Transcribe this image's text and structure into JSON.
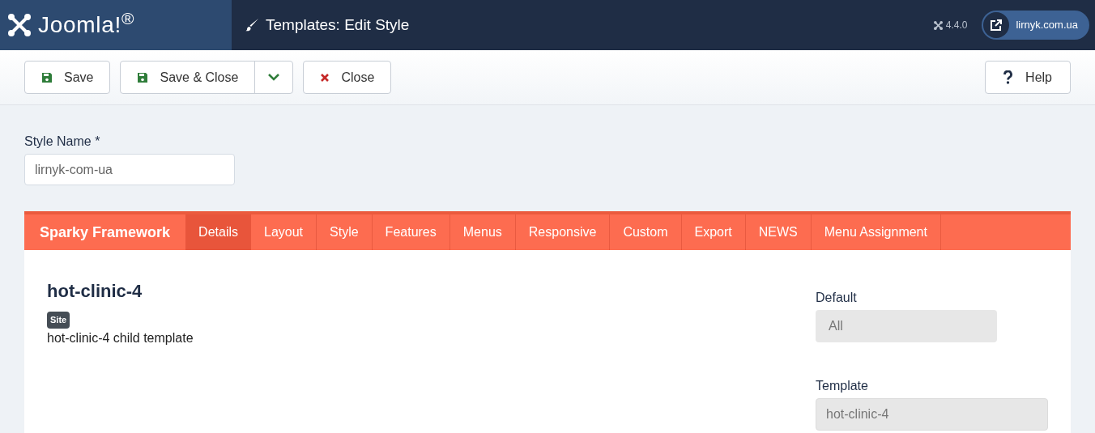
{
  "header": {
    "logo": "Joomla!$^{®}$",
    "title": "Templates: Edit Style",
    "version": "4.4.0",
    "site_link": "lirnyk.com.ua"
  },
  "toolbar": {
    "buttons": [
      {
        "kind": "save",
        "label": "Save"
      },
      {
        "kind": "save-close",
        "label": "Save & Close"
      },
      {
        "kind": "close",
        "label": "Close"
      }
    ],
    "help": "Help"
  },
  "style_name": {
    "label": "Style Name *",
    "value": "lirnyk-com-ua"
  },
  "tabs": {
    "brand": "Sparky Framework",
    "items": [
      {
        "label": "Details",
        "selected": true
      },
      {
        "label": "Layout",
        "selected": false
      },
      {
        "label": "Style",
        "selected": false
      },
      {
        "label": "Features",
        "selected": false
      },
      {
        "label": "Menus",
        "selected": false
      },
      {
        "label": "Responsive",
        "selected": false
      },
      {
        "label": "Custom",
        "selected": false
      },
      {
        "label": "Export",
        "selected": false
      },
      {
        "label": "NEWS",
        "selected": false
      },
      {
        "label": "Menu Assignment",
        "selected": false
      }
    ]
  },
  "details": {
    "title": "hot-clinic-4",
    "badge": "Site",
    "description": "hot-clinic-4 child template",
    "default": {
      "label": "Default",
      "value": "All"
    },
    "template": {
      "label": "Template",
      "value": "hot-clinic-4"
    }
  }
}
